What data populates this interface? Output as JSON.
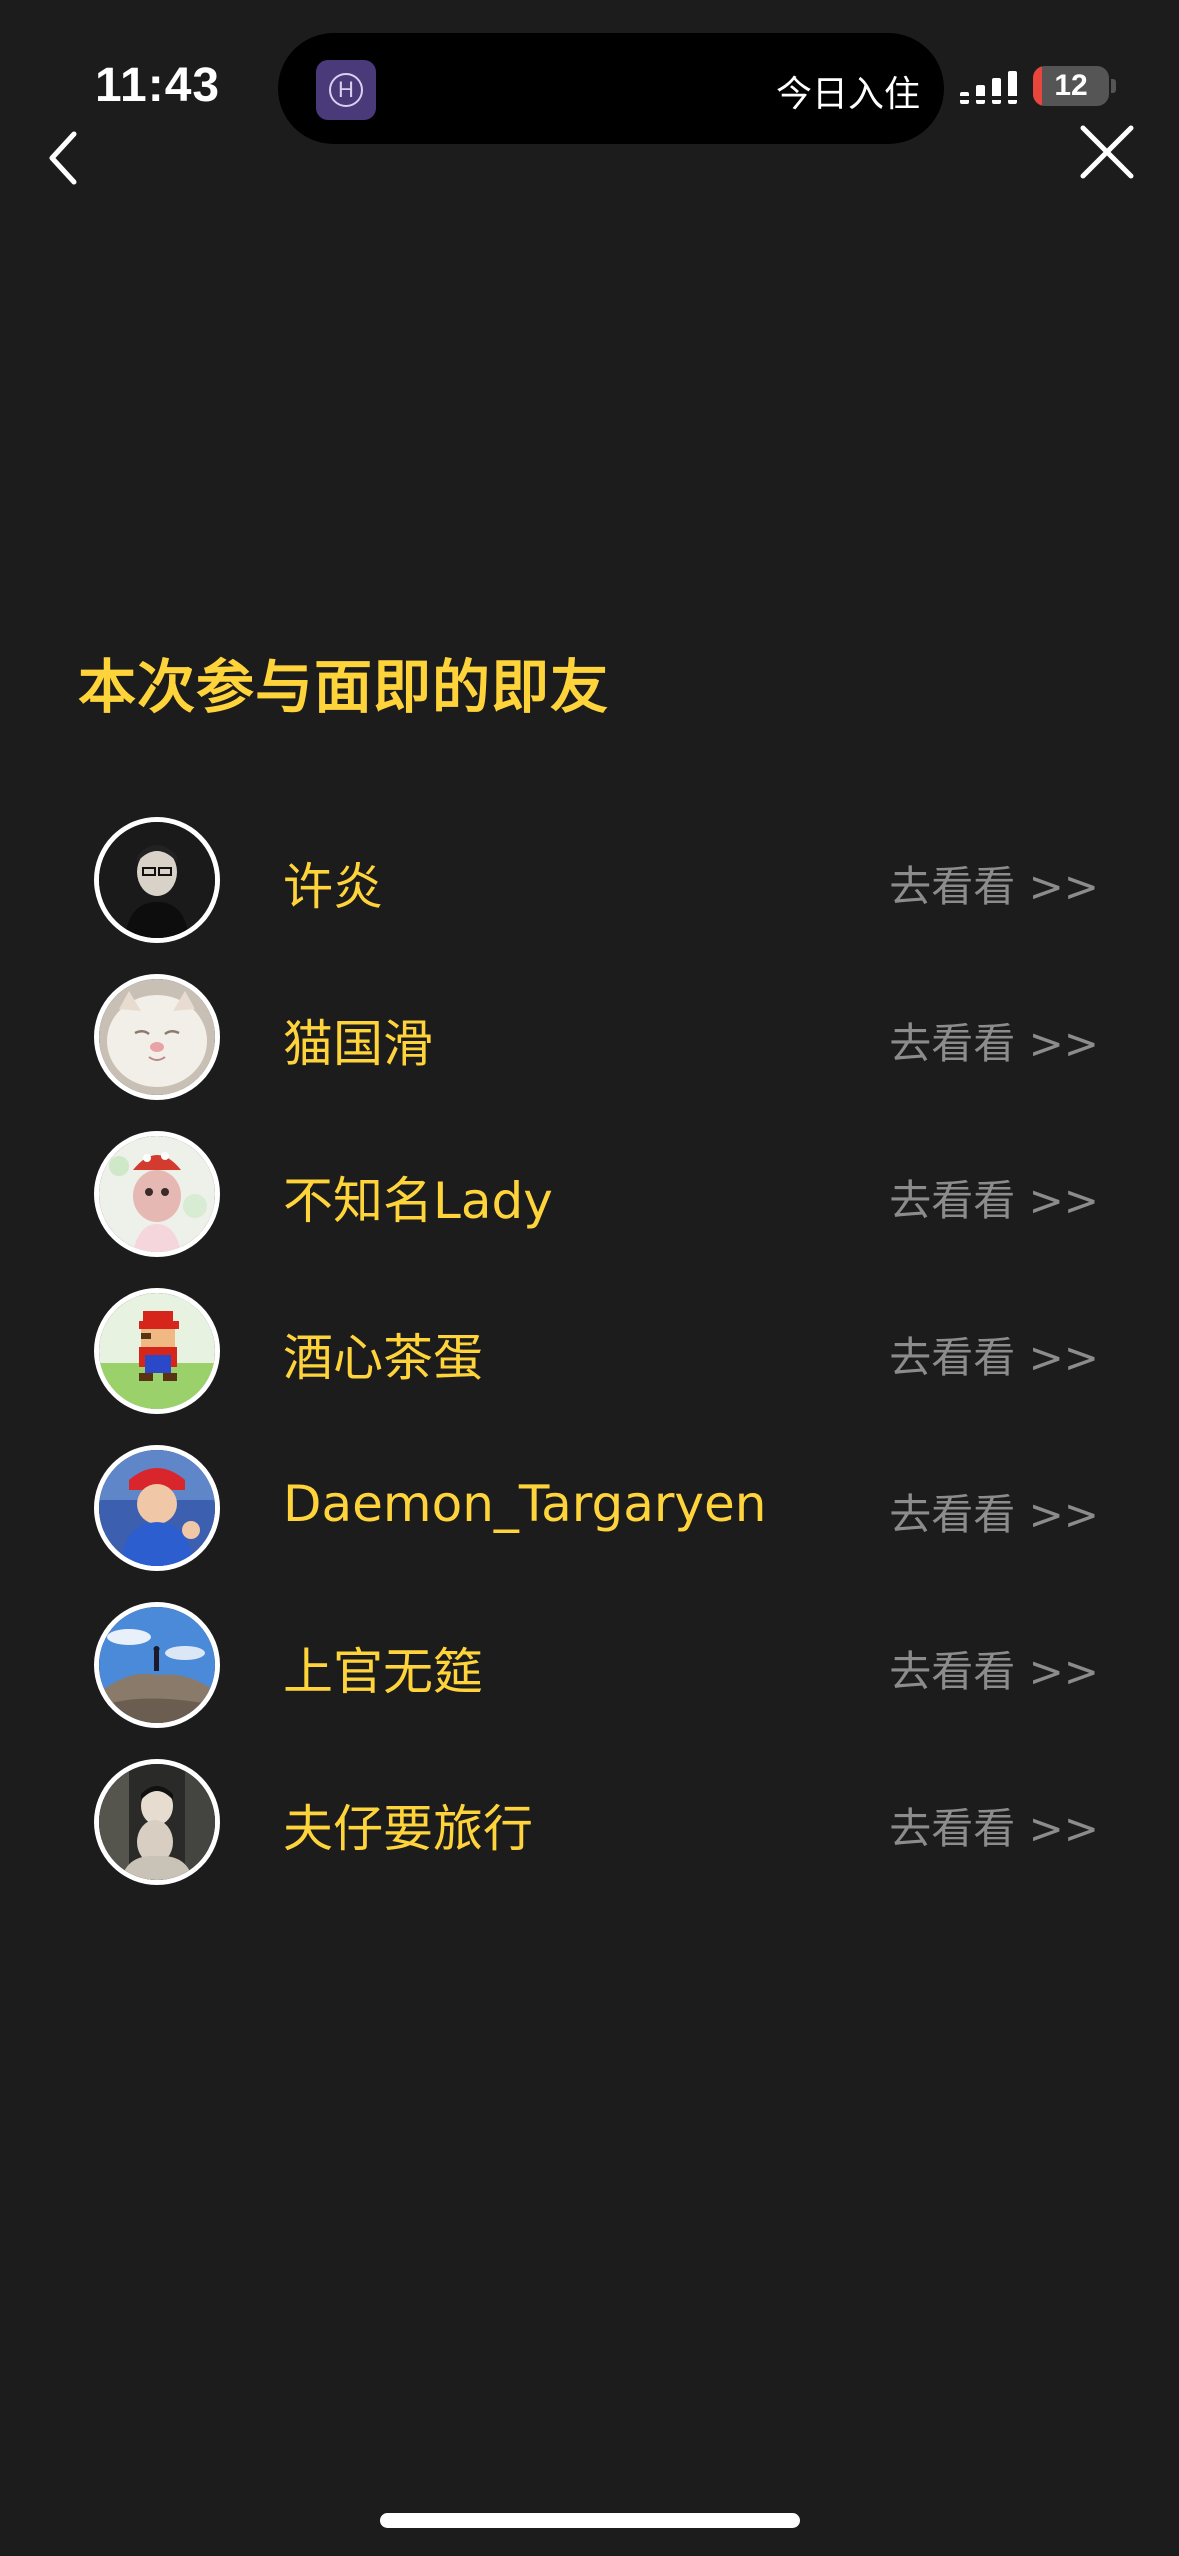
{
  "status_bar": {
    "time": "11:43",
    "island_text": "今日入住",
    "island_app_icon_letter": "H",
    "battery_level": "12",
    "battery_percent": 0.12
  },
  "nav": {
    "back_icon": "chevron-left-icon",
    "close_icon": "close-icon"
  },
  "section": {
    "title": "本次参与面即的即友"
  },
  "colors": {
    "background": "#1c1c1c",
    "accent_yellow": "#ffd43b",
    "link_gray": "#8c8c8c",
    "battery_red": "#e8453c"
  },
  "friends": [
    {
      "name": "许炎",
      "link": "去看看 >>"
    },
    {
      "name": "猫国滑",
      "link": "去看看 >>"
    },
    {
      "name": "不知名Lady",
      "link": "去看看 >>"
    },
    {
      "name": "酒心茶蛋",
      "link": "去看看 >>"
    },
    {
      "name": "Daemon_Targaryen",
      "link": "去看看 >>"
    },
    {
      "name": "上官无筵",
      "link": "去看看 >>"
    },
    {
      "name": "夫仔要旅行",
      "link": "去看看 >>"
    }
  ]
}
